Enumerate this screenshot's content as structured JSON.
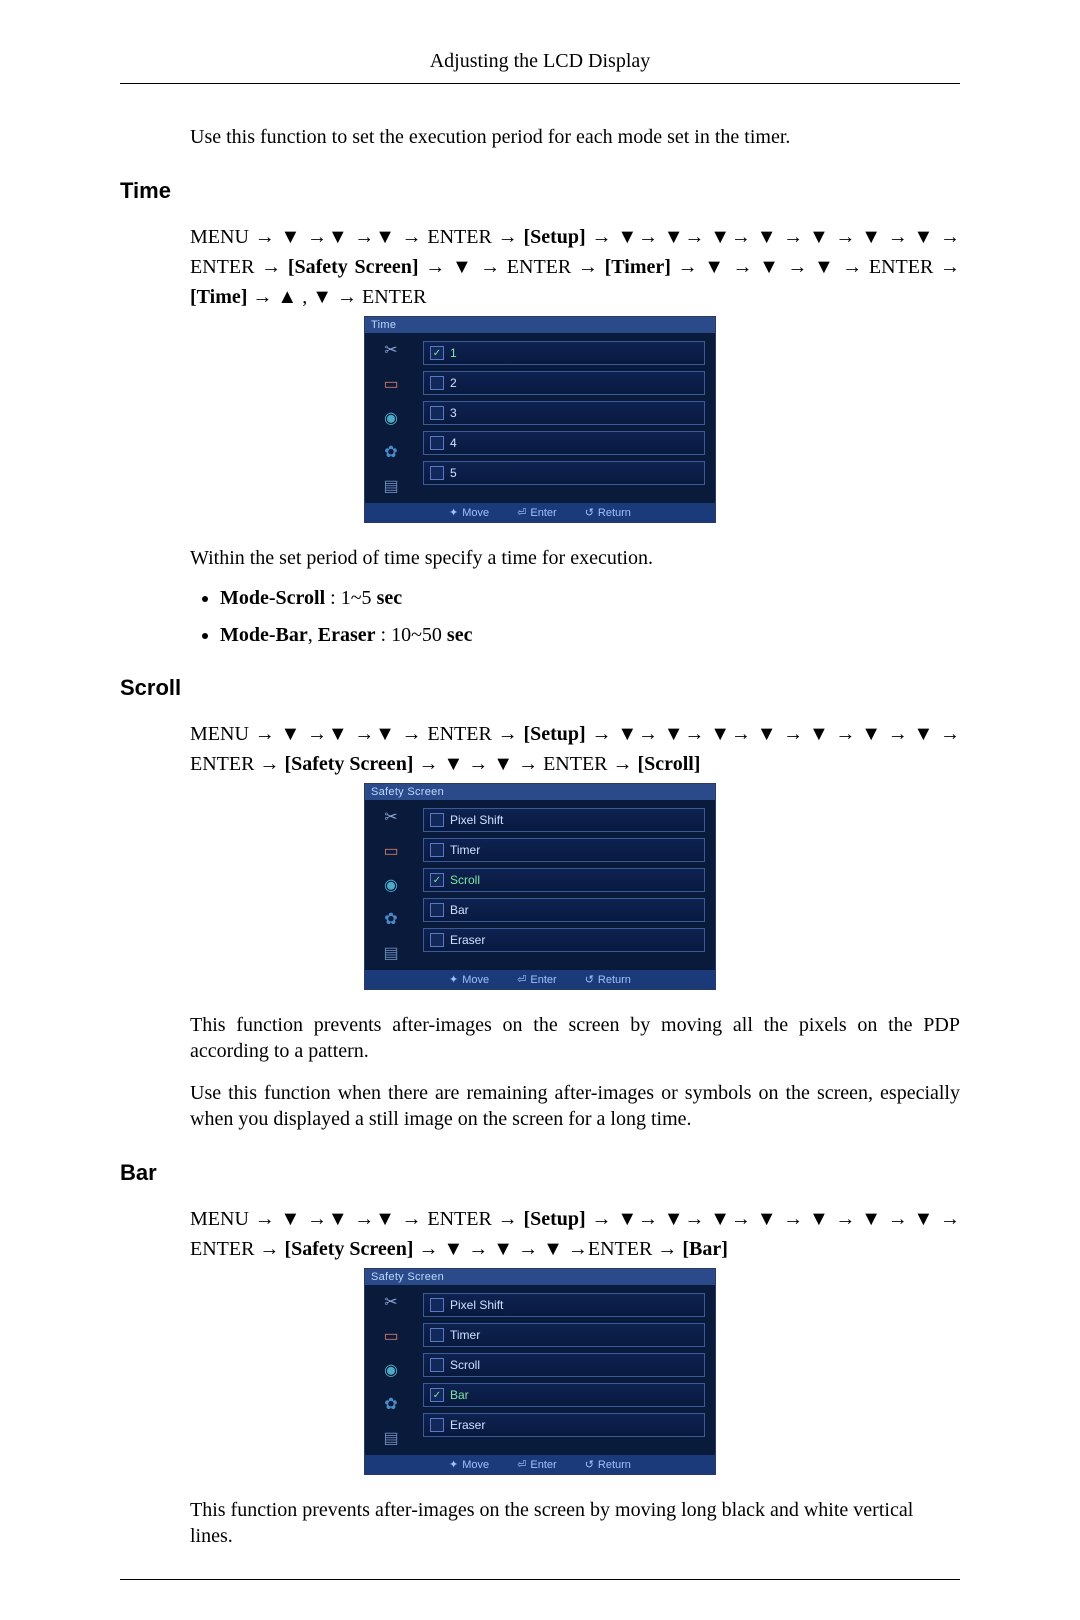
{
  "header": {
    "title": "Adjusting the LCD Display"
  },
  "intro": {
    "paragraph": "Use this function to set the execution period for each mode set in the timer."
  },
  "sections": {
    "time": {
      "heading": "Time",
      "nav_html": "MENU → ▼ →▼ →▼ → ENTER → <b>[Setup]</b> → ▼→ ▼→ ▼→ ▼ → ▼ → ▼ → ▼ → ENTER → <b>[Safety Screen]</b> → ▼ → ENTER → <b>[Timer]</b> → ▼ → ▼ → ▼ → ENTER → <b>[Time]</b> → ▲ , ▼ → ENTER",
      "osd": {
        "title": "Time",
        "items": [
          {
            "label": "1",
            "selected": true
          },
          {
            "label": "2",
            "selected": false
          },
          {
            "label": "3",
            "selected": false
          },
          {
            "label": "4",
            "selected": false
          },
          {
            "label": "5",
            "selected": false
          }
        ],
        "footer": {
          "move": "Move",
          "enter": "Enter",
          "return": "Return"
        }
      },
      "desc": "Within the set period of time specify a time for execution.",
      "bullets": [
        {
          "html": "<b>Mode-Scroll</b> : 1~5 <b>sec</b>"
        },
        {
          "html": "<b>Mode-Bar</b>, <b>Eraser</b> : 10~50 <b>sec</b>"
        }
      ]
    },
    "scroll": {
      "heading": "Scroll",
      "nav_html": "MENU → ▼ →▼ →▼ → ENTER → <b>[Setup]</b> → ▼→ ▼→ ▼→ ▼ → ▼ → ▼ → ▼ → ENTER → <b>[Safety Screen]</b> → ▼ → ▼ → ENTER → <b>[Scroll]</b>",
      "osd": {
        "title": "Safety Screen",
        "items": [
          {
            "label": "Pixel Shift",
            "selected": false
          },
          {
            "label": "Timer",
            "selected": false
          },
          {
            "label": "Scroll",
            "selected": true
          },
          {
            "label": "Bar",
            "selected": false
          },
          {
            "label": "Eraser",
            "selected": false
          }
        ],
        "footer": {
          "move": "Move",
          "enter": "Enter",
          "return": "Return"
        }
      },
      "desc1": "This function prevents after-images on the screen by moving all the pixels on the PDP according to a pattern.",
      "desc2": "Use this function when there are remaining after-images or symbols on the screen, especially when you displayed a still image on the screen for a long time."
    },
    "bar": {
      "heading": "Bar",
      "nav_html": "MENU → ▼ →▼ →▼ → ENTER → <b>[Setup]</b> → ▼→ ▼→ ▼→ ▼ → ▼ → ▼ → ▼ → ENTER → <b>[Safety Screen]</b> → ▼ → ▼ → ▼ →ENTER → <b>[Bar]</b>",
      "osd": {
        "title": "Safety Screen",
        "items": [
          {
            "label": "Pixel Shift",
            "selected": false
          },
          {
            "label": "Timer",
            "selected": false
          },
          {
            "label": "Scroll",
            "selected": false
          },
          {
            "label": "Bar",
            "selected": true
          },
          {
            "label": "Eraser",
            "selected": false
          }
        ],
        "footer": {
          "move": "Move",
          "enter": "Enter",
          "return": "Return"
        }
      },
      "desc": "This function prevents after-images on the screen by moving long black and white vertical lines."
    }
  },
  "osd_side_icons": [
    "tool",
    "pic",
    "sound",
    "gear",
    "multi"
  ],
  "icon_glyph": {
    "tool": "✂",
    "pic": "▭",
    "sound": "◉",
    "gear": "✿",
    "multi": "▤"
  },
  "footer_glyph": {
    "move": "✦",
    "enter": "⏎",
    "return": "↺"
  }
}
